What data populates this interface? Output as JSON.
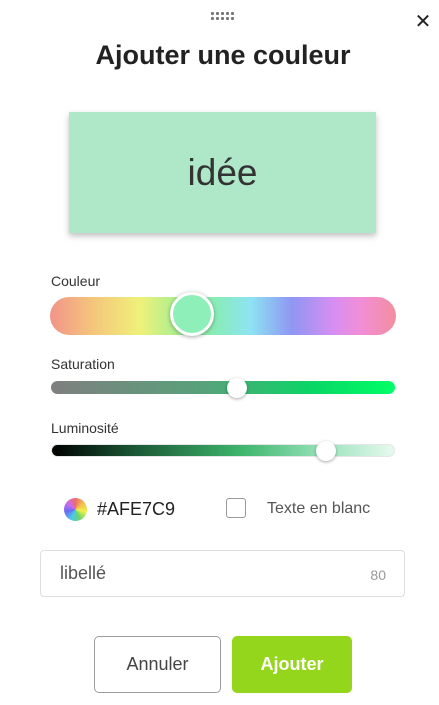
{
  "dialog": {
    "title": "Ajouter une couleur",
    "close_icon": "close-icon",
    "drag_handle_icon": "drag-handle-icon"
  },
  "preview": {
    "text": "idée",
    "background_color": "#AFE7C9"
  },
  "sliders": {
    "hue": {
      "label": "Couleur",
      "value_fraction": 0.41
    },
    "saturation": {
      "label": "Saturation",
      "value_fraction": 0.54
    },
    "luminosity": {
      "label": "Luminosité",
      "value_fraction": 0.8
    }
  },
  "color": {
    "icon": "color-wheel-icon",
    "hex": "#AFE7C9"
  },
  "white_text": {
    "label": "Texte en blanc",
    "checked": false
  },
  "label_input": {
    "placeholder": "libellé",
    "value": "",
    "remaining": "80"
  },
  "buttons": {
    "cancel": "Annuler",
    "add": "Ajouter",
    "add_color": "#94D61C"
  }
}
